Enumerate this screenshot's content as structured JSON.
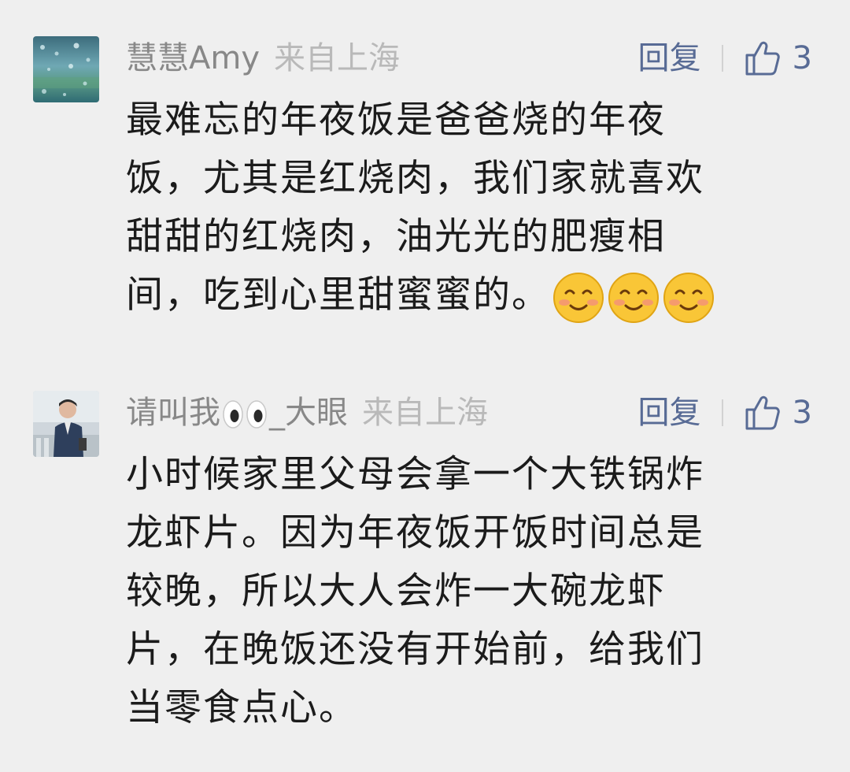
{
  "comments": [
    {
      "nickname": "慧慧Amy",
      "origin": "来自上海",
      "reply_label": "回复",
      "like_count": "3",
      "avatar": "rainy-window-avatar",
      "lines": [
        "最难忘的年夜饭是爸爸烧的年夜",
        "饭，尤其是红烧肉，我们家就喜欢",
        "甜甜的红烧肉，油光光的肥瘦相",
        "间，吃到心里甜蜜蜜的。"
      ],
      "emoji": [
        "smiling-face-emoji",
        "smiling-face-emoji",
        "smiling-face-emoji"
      ]
    },
    {
      "nickname_prefix": "请叫我",
      "nickname_suffix": "_大眼",
      "nickname_emoji": "eyes-emoji",
      "origin": "来自上海",
      "reply_label": "回复",
      "like_count": "3",
      "avatar": "person-photo-avatar",
      "lines": [
        "小时候家里父母会拿一个大铁锅炸",
        "龙虾片。因为年夜饭开饭时间总是",
        "较晚，所以大人会炸一大碗龙虾",
        "片，在晚饭还没有开始前，给我们",
        "当零食点心。"
      ]
    }
  ],
  "colors": {
    "background": "#efefef",
    "nickname": "#888888",
    "origin": "#b9b9b9",
    "action": "#586b95",
    "body_text": "#1b1b1b"
  }
}
